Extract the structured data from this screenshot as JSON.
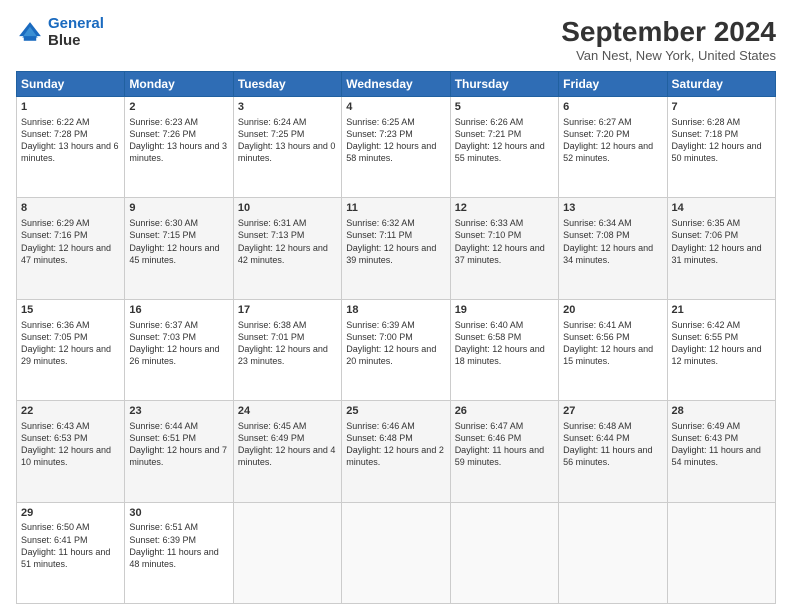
{
  "header": {
    "logo_line1": "General",
    "logo_line2": "Blue",
    "title": "September 2024",
    "subtitle": "Van Nest, New York, United States"
  },
  "days_of_week": [
    "Sunday",
    "Monday",
    "Tuesday",
    "Wednesday",
    "Thursday",
    "Friday",
    "Saturday"
  ],
  "weeks": [
    [
      {
        "day": 1,
        "sunrise": "6:22 AM",
        "sunset": "7:28 PM",
        "daylight": "13 hours and 6 minutes."
      },
      {
        "day": 2,
        "sunrise": "6:23 AM",
        "sunset": "7:26 PM",
        "daylight": "13 hours and 3 minutes."
      },
      {
        "day": 3,
        "sunrise": "6:24 AM",
        "sunset": "7:25 PM",
        "daylight": "13 hours and 0 minutes."
      },
      {
        "day": 4,
        "sunrise": "6:25 AM",
        "sunset": "7:23 PM",
        "daylight": "12 hours and 58 minutes."
      },
      {
        "day": 5,
        "sunrise": "6:26 AM",
        "sunset": "7:21 PM",
        "daylight": "12 hours and 55 minutes."
      },
      {
        "day": 6,
        "sunrise": "6:27 AM",
        "sunset": "7:20 PM",
        "daylight": "12 hours and 52 minutes."
      },
      {
        "day": 7,
        "sunrise": "6:28 AM",
        "sunset": "7:18 PM",
        "daylight": "12 hours and 50 minutes."
      }
    ],
    [
      {
        "day": 8,
        "sunrise": "6:29 AM",
        "sunset": "7:16 PM",
        "daylight": "12 hours and 47 minutes."
      },
      {
        "day": 9,
        "sunrise": "6:30 AM",
        "sunset": "7:15 PM",
        "daylight": "12 hours and 45 minutes."
      },
      {
        "day": 10,
        "sunrise": "6:31 AM",
        "sunset": "7:13 PM",
        "daylight": "12 hours and 42 minutes."
      },
      {
        "day": 11,
        "sunrise": "6:32 AM",
        "sunset": "7:11 PM",
        "daylight": "12 hours and 39 minutes."
      },
      {
        "day": 12,
        "sunrise": "6:33 AM",
        "sunset": "7:10 PM",
        "daylight": "12 hours and 37 minutes."
      },
      {
        "day": 13,
        "sunrise": "6:34 AM",
        "sunset": "7:08 PM",
        "daylight": "12 hours and 34 minutes."
      },
      {
        "day": 14,
        "sunrise": "6:35 AM",
        "sunset": "7:06 PM",
        "daylight": "12 hours and 31 minutes."
      }
    ],
    [
      {
        "day": 15,
        "sunrise": "6:36 AM",
        "sunset": "7:05 PM",
        "daylight": "12 hours and 29 minutes."
      },
      {
        "day": 16,
        "sunrise": "6:37 AM",
        "sunset": "7:03 PM",
        "daylight": "12 hours and 26 minutes."
      },
      {
        "day": 17,
        "sunrise": "6:38 AM",
        "sunset": "7:01 PM",
        "daylight": "12 hours and 23 minutes."
      },
      {
        "day": 18,
        "sunrise": "6:39 AM",
        "sunset": "7:00 PM",
        "daylight": "12 hours and 20 minutes."
      },
      {
        "day": 19,
        "sunrise": "6:40 AM",
        "sunset": "6:58 PM",
        "daylight": "12 hours and 18 minutes."
      },
      {
        "day": 20,
        "sunrise": "6:41 AM",
        "sunset": "6:56 PM",
        "daylight": "12 hours and 15 minutes."
      },
      {
        "day": 21,
        "sunrise": "6:42 AM",
        "sunset": "6:55 PM",
        "daylight": "12 hours and 12 minutes."
      }
    ],
    [
      {
        "day": 22,
        "sunrise": "6:43 AM",
        "sunset": "6:53 PM",
        "daylight": "12 hours and 10 minutes."
      },
      {
        "day": 23,
        "sunrise": "6:44 AM",
        "sunset": "6:51 PM",
        "daylight": "12 hours and 7 minutes."
      },
      {
        "day": 24,
        "sunrise": "6:45 AM",
        "sunset": "6:49 PM",
        "daylight": "12 hours and 4 minutes."
      },
      {
        "day": 25,
        "sunrise": "6:46 AM",
        "sunset": "6:48 PM",
        "daylight": "12 hours and 2 minutes."
      },
      {
        "day": 26,
        "sunrise": "6:47 AM",
        "sunset": "6:46 PM",
        "daylight": "11 hours and 59 minutes."
      },
      {
        "day": 27,
        "sunrise": "6:48 AM",
        "sunset": "6:44 PM",
        "daylight": "11 hours and 56 minutes."
      },
      {
        "day": 28,
        "sunrise": "6:49 AM",
        "sunset": "6:43 PM",
        "daylight": "11 hours and 54 minutes."
      }
    ],
    [
      {
        "day": 29,
        "sunrise": "6:50 AM",
        "sunset": "6:41 PM",
        "daylight": "11 hours and 51 minutes."
      },
      {
        "day": 30,
        "sunrise": "6:51 AM",
        "sunset": "6:39 PM",
        "daylight": "11 hours and 48 minutes."
      },
      null,
      null,
      null,
      null,
      null
    ]
  ]
}
